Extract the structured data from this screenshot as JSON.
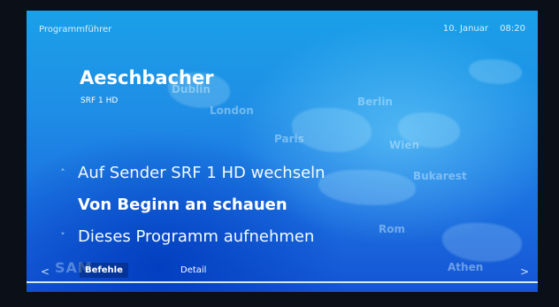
{
  "header": {
    "section": "Programmführer",
    "date": "10. Januar",
    "time": "08:20"
  },
  "program": {
    "title": "Aeschbacher",
    "channel": "SRF 1 HD"
  },
  "menu": {
    "items": [
      {
        "label": "Auf Sender SRF 1 HD wechseln",
        "selected": false,
        "arrow": "˄"
      },
      {
        "label": "Von Beginn an schauen",
        "selected": true,
        "arrow": ""
      },
      {
        "label": "Dieses Programm aufnehmen",
        "selected": false,
        "arrow": "˅"
      }
    ]
  },
  "map_labels": [
    "Dublin",
    "London",
    "Berlin",
    "Paris",
    "Wien",
    "Bukarest",
    "Rom",
    "Athen"
  ],
  "footer": {
    "tabs": [
      "Befehle",
      "Detail"
    ],
    "active_tab": "Befehle",
    "nav_left": "<",
    "nav_right": ">",
    "ghost_text": "SAM"
  },
  "colors": {
    "background_top": "#1aa0e8",
    "background_bottom": "#1454d4",
    "text": "#ffffff"
  }
}
